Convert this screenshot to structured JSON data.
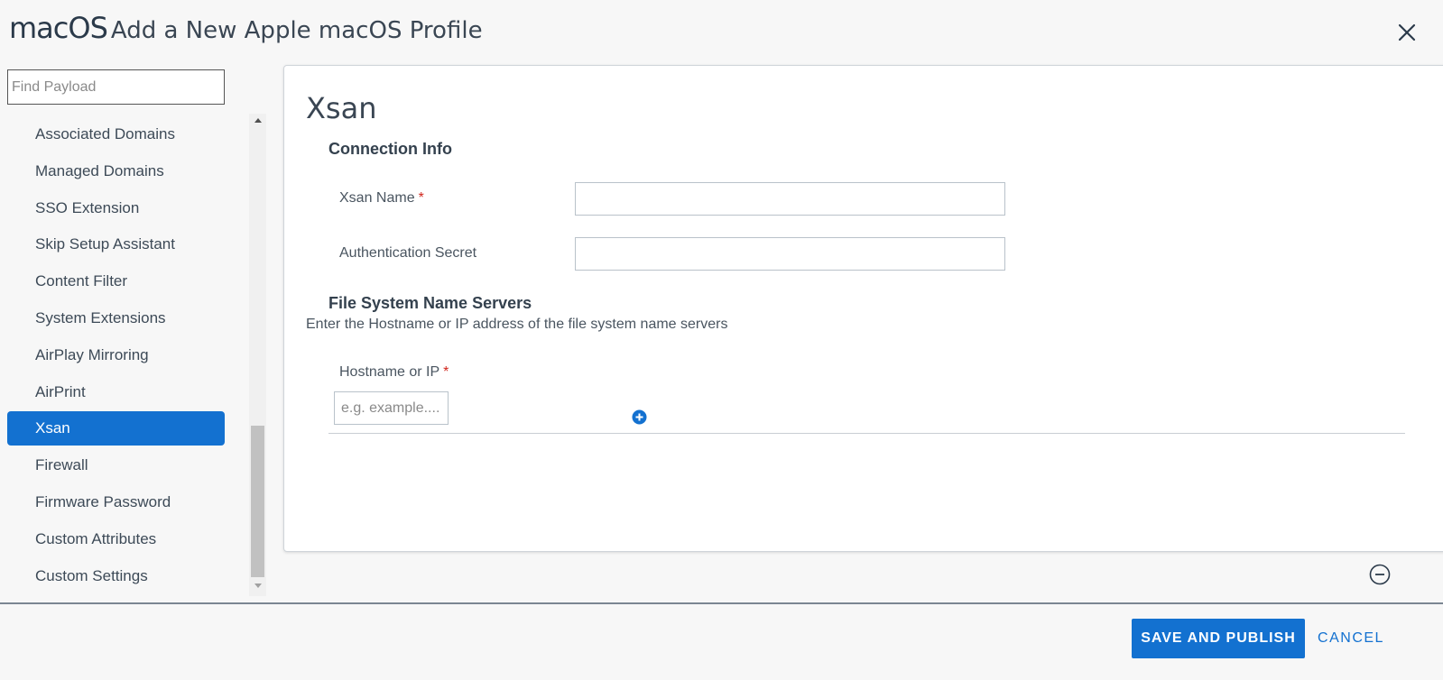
{
  "header": {
    "os_logo": "macOS",
    "title": "Add a New Apple macOS Profile"
  },
  "sidebar": {
    "search_placeholder": "Find Payload",
    "items": [
      {
        "label": "Associated Domains"
      },
      {
        "label": "Managed Domains"
      },
      {
        "label": "SSO Extension"
      },
      {
        "label": "Skip Setup Assistant"
      },
      {
        "label": "Content Filter"
      },
      {
        "label": "System Extensions"
      },
      {
        "label": "AirPlay Mirroring"
      },
      {
        "label": "AirPrint"
      },
      {
        "label": "Xsan",
        "active": true
      },
      {
        "label": "Firewall"
      },
      {
        "label": "Firmware Password"
      },
      {
        "label": "Custom Attributes"
      },
      {
        "label": "Custom Settings"
      }
    ]
  },
  "form": {
    "title": "Xsan",
    "connection_info": {
      "heading": "Connection Info",
      "xsan_name_label": "Xsan Name",
      "xsan_name_value": "",
      "auth_secret_label": "Authentication Secret",
      "auth_secret_value": ""
    },
    "name_servers": {
      "heading": "File System Name Servers",
      "hint": "Enter the Hostname or IP address of the file system name servers",
      "hostname_label": "Hostname or IP",
      "hostname_placeholder": "e.g. example...."
    },
    "required_marker": "*"
  },
  "footer": {
    "save_label": "SAVE AND PUBLISH",
    "cancel_label": "CANCEL"
  },
  "colors": {
    "accent": "#1371d0",
    "required": "#d0261d"
  },
  "icons": [
    "close-icon",
    "add-circle-icon",
    "remove-circle-icon",
    "scroll-up-arrow-icon",
    "scroll-down-arrow-icon"
  ]
}
